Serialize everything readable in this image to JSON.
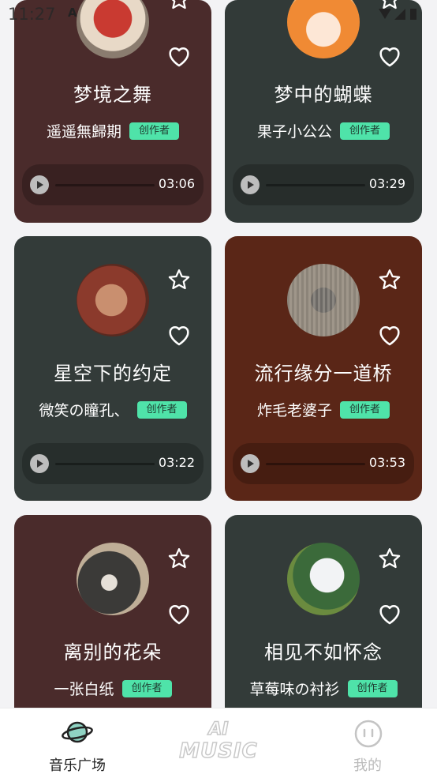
{
  "status_bar": {
    "time": "11:27",
    "notification": "A"
  },
  "cards": [
    {
      "title": "梦境之舞",
      "author": "遥遥無歸期",
      "badge": "创作者",
      "duration": "03:06",
      "bg": "#4a2b2b",
      "avatar_colors": [
        "#c93a31",
        "#e8d9c7"
      ]
    },
    {
      "title": "梦中的蝴蝶",
      "author": "果子小公公",
      "badge": "创作者",
      "duration": "03:29",
      "bg": "#323a38",
      "avatar_colors": [
        "#f08a34",
        "#fde7d6"
      ]
    },
    {
      "title": "星空下的约定",
      "author": "微笑の瞳孔、",
      "badge": "创作者",
      "duration": "03:22",
      "bg": "#333b39",
      "avatar_colors": [
        "#8b3a2c",
        "#c98f6f"
      ]
    },
    {
      "title": "流行缘分一道桥",
      "author": "炸毛老婆子",
      "badge": "创作者",
      "duration": "03:53",
      "bg": "#5a2617",
      "avatar_colors": [
        "#6d6a66",
        "#c7b49f"
      ]
    },
    {
      "title": "离别的花朵",
      "author": "一张白纸",
      "badge": "创作者",
      "duration": "",
      "bg": "#4a2b2b",
      "avatar_colors": [
        "#bfae97",
        "#3b3a38"
      ]
    },
    {
      "title": "相见不如怀念",
      "author": "草莓味の衬衫",
      "badge": "创作者",
      "duration": "",
      "bg": "#333b39",
      "avatar_colors": [
        "#e6e8ec",
        "#3b6a3a"
      ]
    }
  ],
  "tabbar": {
    "tabs": [
      {
        "label": "音乐广场",
        "active": true
      },
      {
        "label": "我的",
        "active": false
      }
    ],
    "center_logo_line1": "AI",
    "center_logo_line2": "MUSIC"
  },
  "colors": {
    "badge": "#4fe3a9",
    "active_tab": "#222222",
    "inactive_tab": "#bbbbbb"
  }
}
